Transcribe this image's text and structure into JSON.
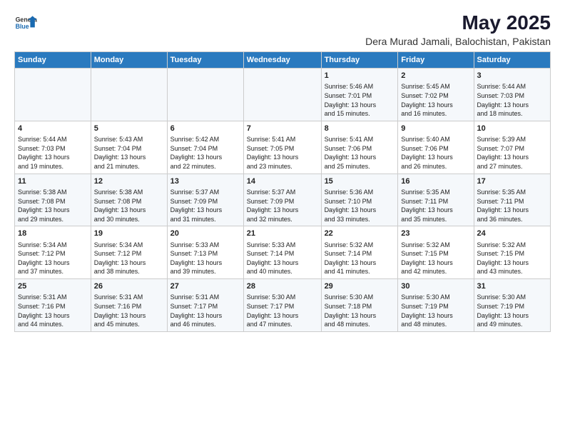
{
  "header": {
    "logo_line1": "General",
    "logo_line2": "Blue",
    "title": "May 2025",
    "subtitle": "Dera Murad Jamali, Balochistan, Pakistan"
  },
  "days_of_week": [
    "Sunday",
    "Monday",
    "Tuesday",
    "Wednesday",
    "Thursday",
    "Friday",
    "Saturday"
  ],
  "weeks": [
    [
      {
        "day": "",
        "text": ""
      },
      {
        "day": "",
        "text": ""
      },
      {
        "day": "",
        "text": ""
      },
      {
        "day": "",
        "text": ""
      },
      {
        "day": "1",
        "text": "Sunrise: 5:46 AM\nSunset: 7:01 PM\nDaylight: 13 hours\nand 15 minutes."
      },
      {
        "day": "2",
        "text": "Sunrise: 5:45 AM\nSunset: 7:02 PM\nDaylight: 13 hours\nand 16 minutes."
      },
      {
        "day": "3",
        "text": "Sunrise: 5:44 AM\nSunset: 7:03 PM\nDaylight: 13 hours\nand 18 minutes."
      }
    ],
    [
      {
        "day": "4",
        "text": "Sunrise: 5:44 AM\nSunset: 7:03 PM\nDaylight: 13 hours\nand 19 minutes."
      },
      {
        "day": "5",
        "text": "Sunrise: 5:43 AM\nSunset: 7:04 PM\nDaylight: 13 hours\nand 21 minutes."
      },
      {
        "day": "6",
        "text": "Sunrise: 5:42 AM\nSunset: 7:04 PM\nDaylight: 13 hours\nand 22 minutes."
      },
      {
        "day": "7",
        "text": "Sunrise: 5:41 AM\nSunset: 7:05 PM\nDaylight: 13 hours\nand 23 minutes."
      },
      {
        "day": "8",
        "text": "Sunrise: 5:41 AM\nSunset: 7:06 PM\nDaylight: 13 hours\nand 25 minutes."
      },
      {
        "day": "9",
        "text": "Sunrise: 5:40 AM\nSunset: 7:06 PM\nDaylight: 13 hours\nand 26 minutes."
      },
      {
        "day": "10",
        "text": "Sunrise: 5:39 AM\nSunset: 7:07 PM\nDaylight: 13 hours\nand 27 minutes."
      }
    ],
    [
      {
        "day": "11",
        "text": "Sunrise: 5:38 AM\nSunset: 7:08 PM\nDaylight: 13 hours\nand 29 minutes."
      },
      {
        "day": "12",
        "text": "Sunrise: 5:38 AM\nSunset: 7:08 PM\nDaylight: 13 hours\nand 30 minutes."
      },
      {
        "day": "13",
        "text": "Sunrise: 5:37 AM\nSunset: 7:09 PM\nDaylight: 13 hours\nand 31 minutes."
      },
      {
        "day": "14",
        "text": "Sunrise: 5:37 AM\nSunset: 7:09 PM\nDaylight: 13 hours\nand 32 minutes."
      },
      {
        "day": "15",
        "text": "Sunrise: 5:36 AM\nSunset: 7:10 PM\nDaylight: 13 hours\nand 33 minutes."
      },
      {
        "day": "16",
        "text": "Sunrise: 5:35 AM\nSunset: 7:11 PM\nDaylight: 13 hours\nand 35 minutes."
      },
      {
        "day": "17",
        "text": "Sunrise: 5:35 AM\nSunset: 7:11 PM\nDaylight: 13 hours\nand 36 minutes."
      }
    ],
    [
      {
        "day": "18",
        "text": "Sunrise: 5:34 AM\nSunset: 7:12 PM\nDaylight: 13 hours\nand 37 minutes."
      },
      {
        "day": "19",
        "text": "Sunrise: 5:34 AM\nSunset: 7:12 PM\nDaylight: 13 hours\nand 38 minutes."
      },
      {
        "day": "20",
        "text": "Sunrise: 5:33 AM\nSunset: 7:13 PM\nDaylight: 13 hours\nand 39 minutes."
      },
      {
        "day": "21",
        "text": "Sunrise: 5:33 AM\nSunset: 7:14 PM\nDaylight: 13 hours\nand 40 minutes."
      },
      {
        "day": "22",
        "text": "Sunrise: 5:32 AM\nSunset: 7:14 PM\nDaylight: 13 hours\nand 41 minutes."
      },
      {
        "day": "23",
        "text": "Sunrise: 5:32 AM\nSunset: 7:15 PM\nDaylight: 13 hours\nand 42 minutes."
      },
      {
        "day": "24",
        "text": "Sunrise: 5:32 AM\nSunset: 7:15 PM\nDaylight: 13 hours\nand 43 minutes."
      }
    ],
    [
      {
        "day": "25",
        "text": "Sunrise: 5:31 AM\nSunset: 7:16 PM\nDaylight: 13 hours\nand 44 minutes."
      },
      {
        "day": "26",
        "text": "Sunrise: 5:31 AM\nSunset: 7:16 PM\nDaylight: 13 hours\nand 45 minutes."
      },
      {
        "day": "27",
        "text": "Sunrise: 5:31 AM\nSunset: 7:17 PM\nDaylight: 13 hours\nand 46 minutes."
      },
      {
        "day": "28",
        "text": "Sunrise: 5:30 AM\nSunset: 7:17 PM\nDaylight: 13 hours\nand 47 minutes."
      },
      {
        "day": "29",
        "text": "Sunrise: 5:30 AM\nSunset: 7:18 PM\nDaylight: 13 hours\nand 48 minutes."
      },
      {
        "day": "30",
        "text": "Sunrise: 5:30 AM\nSunset: 7:19 PM\nDaylight: 13 hours\nand 48 minutes."
      },
      {
        "day": "31",
        "text": "Sunrise: 5:30 AM\nSunset: 7:19 PM\nDaylight: 13 hours\nand 49 minutes."
      }
    ]
  ]
}
